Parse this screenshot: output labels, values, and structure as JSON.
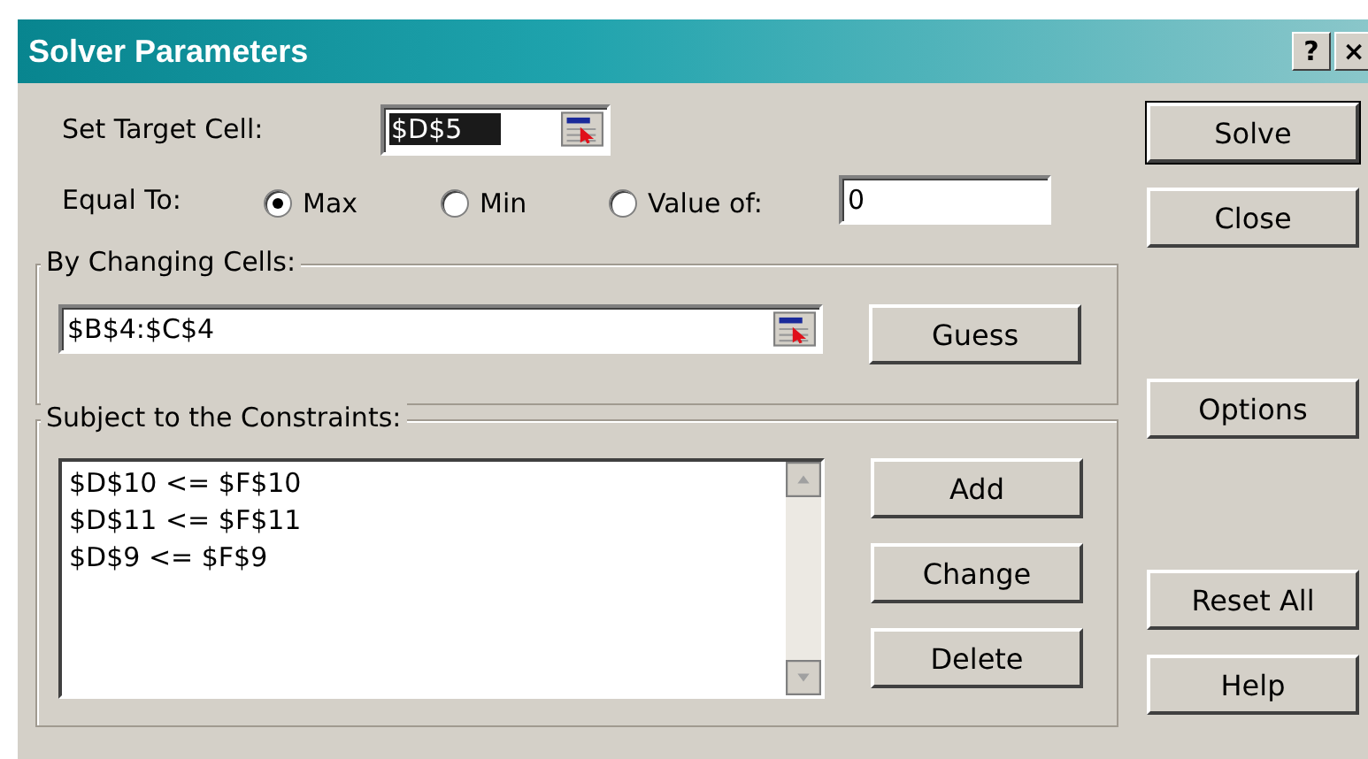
{
  "window": {
    "title": "Solver Parameters",
    "title_buttons": [
      "?",
      "×"
    ]
  },
  "target_cell": {
    "label": "Set Target Cell:",
    "value": "$D$5",
    "selected": true
  },
  "equal_to": {
    "label": "Equal To:",
    "options": [
      {
        "label": "Max",
        "selected": true
      },
      {
        "label": "Min",
        "selected": false
      },
      {
        "label": "Value of:",
        "selected": false
      }
    ],
    "value": "0"
  },
  "changing_cells": {
    "title": "By Changing Cells:",
    "value": "$B$4:$C$4",
    "button": "Guess"
  },
  "constraints": {
    "title": "Subject to the Constraints:",
    "items": [
      "$D$10 <= $F$10",
      "$D$11 <= $F$11",
      "$D$9 <= $F$9"
    ],
    "buttons": [
      "Add",
      "Change",
      "Delete"
    ]
  },
  "side_buttons": [
    {
      "label": "Solve",
      "default": true
    },
    {
      "label": "Close",
      "default": false
    },
    {
      "label": "Options",
      "default": false
    },
    {
      "label": "Reset All",
      "default": false
    },
    {
      "label": "Help",
      "default": false
    }
  ]
}
